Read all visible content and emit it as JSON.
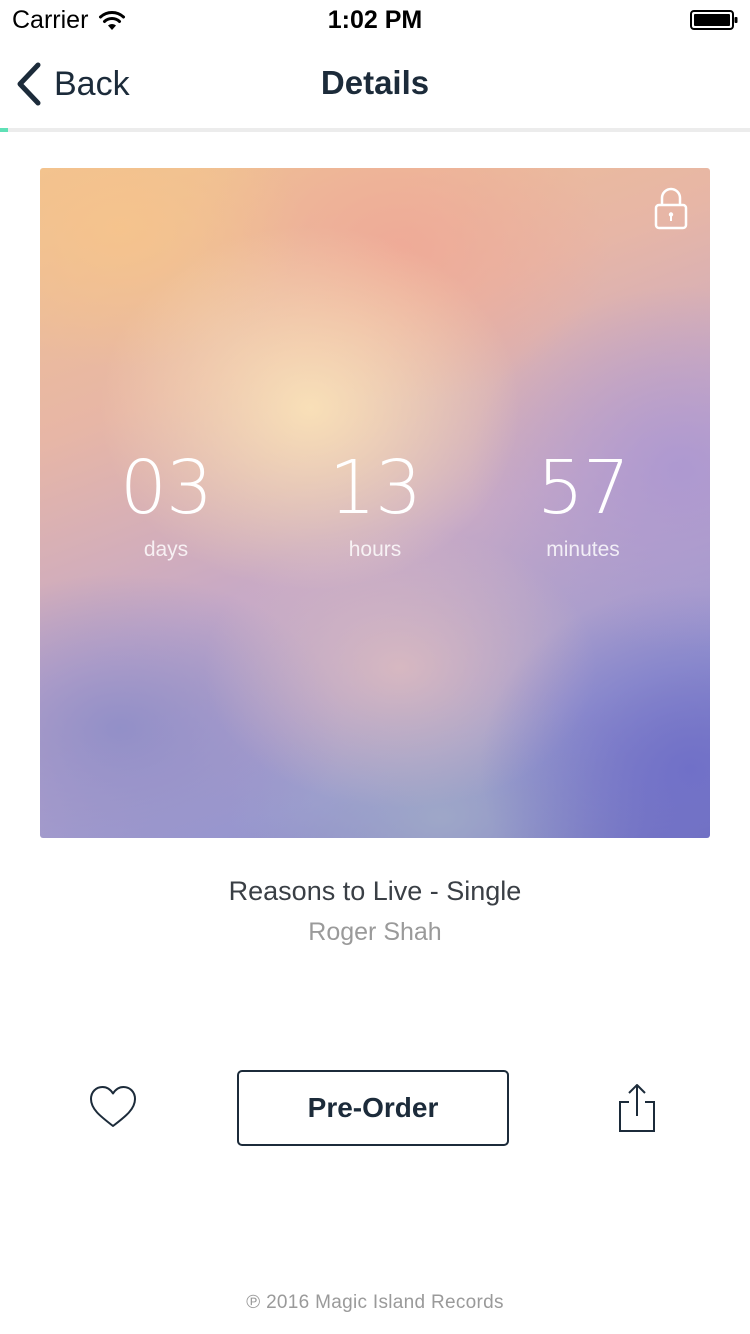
{
  "status_bar": {
    "carrier": "Carrier",
    "time": "1:02 PM",
    "icons": [
      "wifi-icon",
      "battery-icon"
    ]
  },
  "nav": {
    "back_label": "Back",
    "title": "Details",
    "back_icon": "chevron-left-icon",
    "progress": 0.01,
    "progress_color": "#5fe0b6"
  },
  "artwork": {
    "lock_icon": "lock-icon",
    "countdown": [
      {
        "value": "03",
        "label": "days"
      },
      {
        "value": "13",
        "label": "hours"
      },
      {
        "value": "57",
        "label": "minutes"
      }
    ]
  },
  "release": {
    "title": "Reasons to Live - Single",
    "artist": "Roger Shah"
  },
  "actions": {
    "favorite_icon": "heart-icon",
    "preorder_label": "Pre-Order",
    "share_icon": "share-icon"
  },
  "footer": {
    "copyright": "℗ 2016 Magic Island Records"
  },
  "colors": {
    "primary_text": "#1c2b3a",
    "secondary_text": "#9a9a9a",
    "accent": "#5fe0b6"
  }
}
